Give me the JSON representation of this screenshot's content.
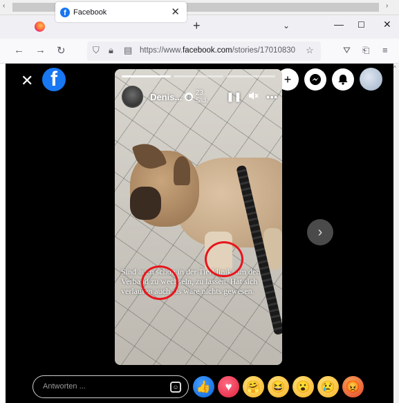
{
  "browser": {
    "tab_title": "Facebook",
    "tab_close": "✕",
    "new_tab": "+",
    "tab_list": "⌄",
    "window_controls": {
      "minimize": "—",
      "maximize": "☐",
      "close": "✕"
    },
    "nav": {
      "back": "←",
      "forward": "→",
      "reload": "↻"
    },
    "url_prefix": "https://www.",
    "url_domain": "facebook.com",
    "url_path": "/stories/17010830",
    "icons": [
      "shield-icon",
      "lock-icon",
      "reader-icon",
      "bookmark-star-icon",
      "pocket-icon",
      "extensions-icon",
      "menu-icon"
    ]
  },
  "page": {
    "close_label": "✕",
    "logo": "f",
    "right_buttons": {
      "create": "+",
      "messenger": "◉",
      "notifications": "🔔"
    },
    "story": {
      "progress_segments": 3,
      "progress_done": 1,
      "author": "Denis...",
      "time": "23 Std.",
      "pause": "❚❚",
      "mute": "🔇",
      "more": "•••",
      "caption": "Sind auch schon in der Tierklinik, um den Verband zu wechseln, zu lassen. Hat sich verlaufen auch als wäre nichts gewesen."
    },
    "next": "›",
    "reply": {
      "placeholder": "Antworten ...",
      "sticker_label": "☺"
    },
    "reactions": [
      {
        "name": "like",
        "glyph": "👍"
      },
      {
        "name": "love",
        "glyph": "♥"
      },
      {
        "name": "care",
        "glyph": "🤗"
      },
      {
        "name": "haha",
        "glyph": "😆"
      },
      {
        "name": "wow",
        "glyph": "😮"
      },
      {
        "name": "sad",
        "glyph": "😢"
      },
      {
        "name": "angry",
        "glyph": "😡"
      }
    ],
    "colors": {
      "facebook_blue": "#1877f2",
      "highlight_ring": "#e8141c",
      "background": "#000000"
    }
  }
}
